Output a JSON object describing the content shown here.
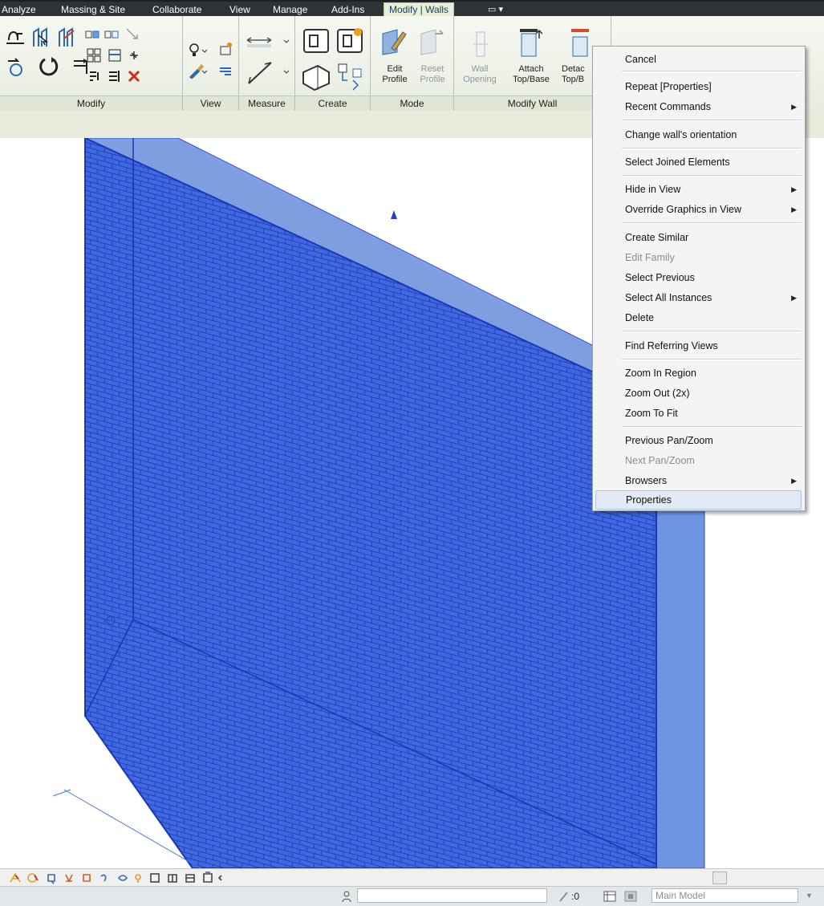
{
  "tabs": [
    "Analyze",
    "Massing & Site",
    "Collaborate",
    "View",
    "Manage",
    "Add-Ins",
    "Modify | Walls"
  ],
  "quick_access": "▭ ▾",
  "ribbon": {
    "panels": [
      "Modify",
      "View",
      "Measure",
      "Create",
      "Mode",
      "Modify Wall"
    ],
    "mode_buttons": [
      {
        "line1": "Edit",
        "line2": "Profile"
      },
      {
        "line1": "Reset",
        "line2": "Profile"
      }
    ],
    "wall_buttons": [
      {
        "line1": "Wall",
        "line2": "Opening"
      },
      {
        "line1": "Attach",
        "line2": "Top/Base"
      },
      {
        "line1": "Detac",
        "line2": "Top/B"
      }
    ]
  },
  "context_menu": {
    "items": [
      {
        "label": "Cancel"
      },
      {
        "label": "Repeat [Properties]"
      },
      {
        "label": "Recent Commands",
        "submenu": true
      },
      {
        "label": "Change wall's orientation"
      },
      {
        "label": "Select Joined Elements"
      },
      {
        "label": "Hide in View",
        "submenu": true
      },
      {
        "label": "Override Graphics in View",
        "submenu": true
      },
      {
        "label": "Create Similar"
      },
      {
        "label": "Edit Family",
        "disabled": true
      },
      {
        "label": "Select Previous"
      },
      {
        "label": "Select All Instances",
        "submenu": true
      },
      {
        "label": "Delete"
      },
      {
        "label": "Find Referring Views"
      },
      {
        "label": "Zoom In Region"
      },
      {
        "label": "Zoom Out (2x)"
      },
      {
        "label": "Zoom To Fit"
      },
      {
        "label": "Previous Pan/Zoom"
      },
      {
        "label": "Next Pan/Zoom",
        "disabled": true
      },
      {
        "label": "Browsers",
        "submenu": true
      },
      {
        "label": "Properties",
        "highlighted": true
      }
    ]
  },
  "status_bar": {
    "zero_label": ":0",
    "model_combo": "Main Model"
  },
  "colors": {
    "wall_face": "#3f67dc",
    "wall_top": "#7e9ee0",
    "wall_side": "#6f94e2",
    "brick_line": "#1e3fc4",
    "ribbon_bg": "#eef2e7",
    "menu_highlight": "#e1eaf6"
  },
  "icons": [
    "align-icon",
    "offset-icon",
    "mirror-icon",
    "rotate-icon",
    "move-icon",
    "copy-icon",
    "array-icon",
    "scale-icon",
    "pin-icon",
    "delete-icon",
    "hide-bulb-icon",
    "paint-brush-icon",
    "dimension-icon",
    "group-icon",
    "component-icon",
    "edit-profile-icon",
    "reset-profile-icon",
    "attach-icon",
    "detach-icon"
  ]
}
